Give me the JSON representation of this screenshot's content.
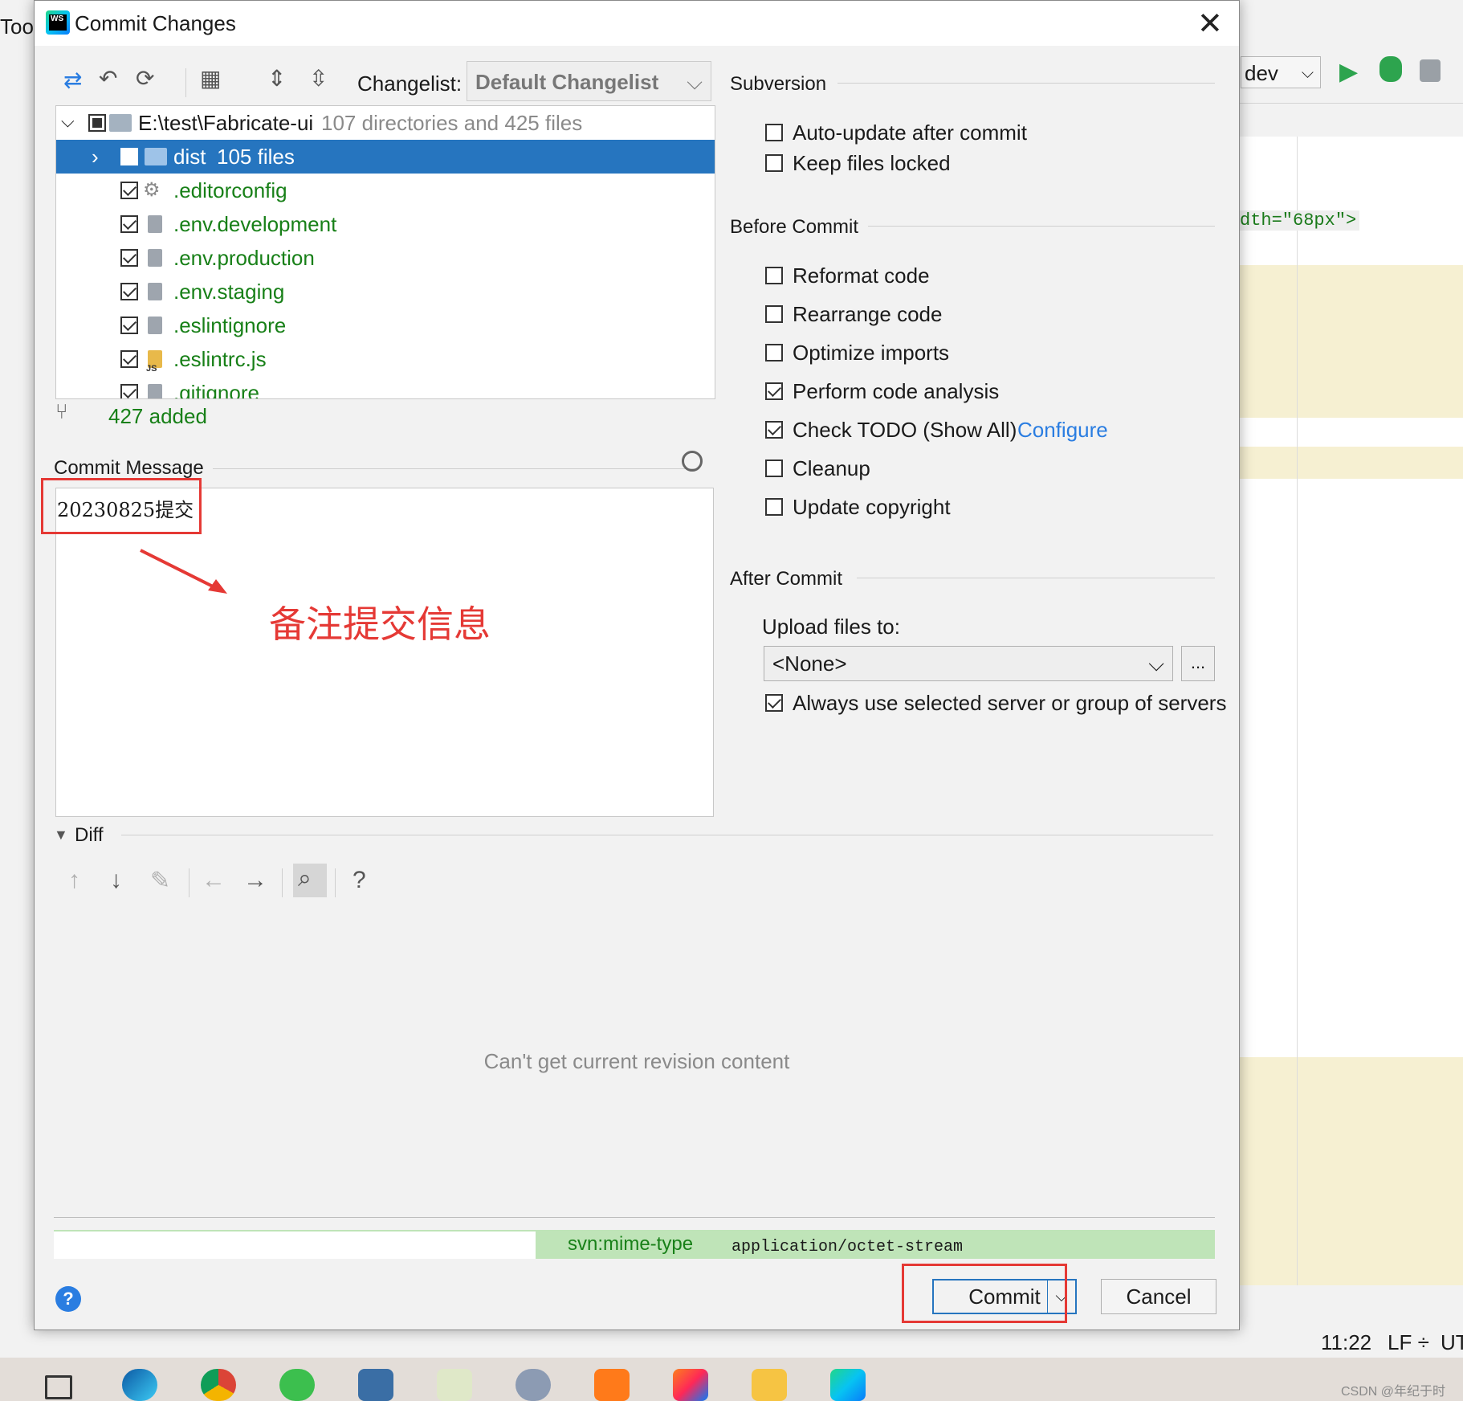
{
  "ide": {
    "top_menu_fragment": "Tool",
    "branch": "dev",
    "code_fragment": "dth=\"68px\">",
    "status": {
      "time": "11:22",
      "line_ending": "LF ÷",
      "encoding": "UT"
    },
    "watermark": "CSDN @年纪于时"
  },
  "dialog": {
    "title": "Commit Changes",
    "changelist_label": "Changelist:",
    "changelist_value": "Default Changelist",
    "tree": {
      "root": {
        "path": "E:\\test\\Fabricate-ui",
        "summary": "107 directories and 425 files"
      },
      "items": [
        {
          "name": "dist",
          "extra": "105 files"
        },
        {
          "name": ".editorconfig"
        },
        {
          "name": ".env.development"
        },
        {
          "name": ".env.production"
        },
        {
          "name": ".env.staging"
        },
        {
          "name": ".eslintignore"
        },
        {
          "name": ".eslintrc.js",
          "badge": "JS"
        },
        {
          "name": ".gitignore"
        }
      ]
    },
    "added_summary": "427 added",
    "commit_message_label": "Commit Message",
    "commit_message": "20230825提交",
    "annotation": "备注提交信息",
    "subversion": {
      "header": "Subversion",
      "options": [
        {
          "label": "Auto-update after commit",
          "checked": false
        },
        {
          "label": "Keep files locked",
          "checked": false
        }
      ]
    },
    "before_commit": {
      "header": "Before Commit",
      "options": [
        {
          "label": "Reformat code",
          "checked": false
        },
        {
          "label": "Rearrange code",
          "checked": false
        },
        {
          "label": "Optimize imports",
          "checked": false
        },
        {
          "label": "Perform code analysis",
          "checked": true
        },
        {
          "label": "Check TODO (Show All)",
          "checked": true,
          "link": "Configure"
        },
        {
          "label": "Cleanup",
          "checked": false
        },
        {
          "label": "Update copyright",
          "checked": false
        }
      ]
    },
    "after_commit": {
      "header": "After Commit",
      "upload_label": "Upload files to:",
      "upload_value": "<None>",
      "browse_label": "...",
      "always_use_label": "Always use selected server or group of servers"
    },
    "diff": {
      "header": "Diff",
      "message": "Can't get current revision content",
      "property_name": "svn:mime-type",
      "property_value": "application/octet-stream"
    },
    "buttons": {
      "commit": "Commit",
      "cancel": "Cancel",
      "help": "?"
    }
  }
}
